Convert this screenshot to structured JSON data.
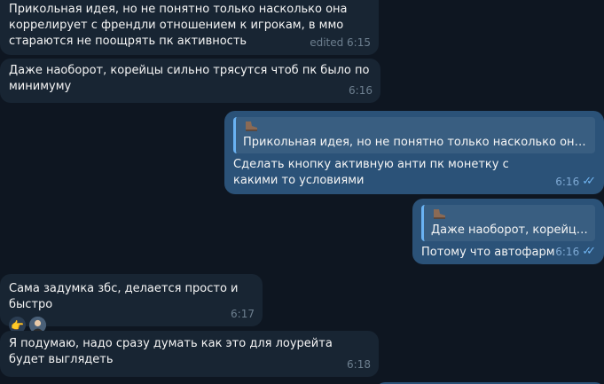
{
  "messages": [
    {
      "text": "Прикольная идея, но не понятно только насколько она коррелирует с френдли отношением к игрокам, в ммо стараются не поощрять пк активность",
      "time": "edited 6:15"
    },
    {
      "text": "Даже наоборот, корейцы сильно трясутся чтоб пк было по минимуму",
      "time": "6:16"
    },
    {
      "quote_author_icon": "boot-emoji-icon",
      "quote_text": "Прикольная идея, но не понятно только насколько она корр...",
      "text": "Сделать кнопку активную анти пк монетку с какими то условиями",
      "time": "6:16",
      "status": "read"
    },
    {
      "quote_author_icon": "boot-emoji-icon",
      "quote_text": "Даже наоборот, корейцы с...",
      "text": "Потому что автофарм",
      "time": "6:16",
      "status": "read"
    },
    {
      "text": "Сама задумка збс, делается просто и быстро",
      "reactions": [
        "pointing-hand-emoji",
        "avatar"
      ],
      "time": "6:17"
    },
    {
      "text": "Я подумаю, надо сразу думать как это для лоурейта будет выглядеть",
      "time": "6:18"
    }
  ],
  "colors": {
    "background": "#0e1621",
    "incoming_bubble": "#182533",
    "outgoing_bubble": "#2b5278",
    "accent": "#6ab2f2"
  }
}
